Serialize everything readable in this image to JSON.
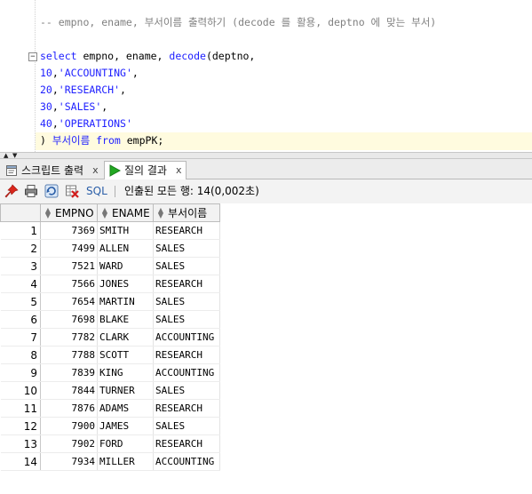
{
  "editor": {
    "comment": "-- empno, ename, 부서이름 출력하기 (decode 를 활용, deptno 에 맞는 부서)",
    "lines": [
      {
        "kw": "select",
        "rest": " empno, ename, ",
        "fn": "decode",
        "tail": "(deptno,"
      },
      {
        "num": "10",
        "str": "'ACCOUNTING'",
        "sep": ","
      },
      {
        "num": "20",
        "str": "'RESEARCH'",
        "sep": ","
      },
      {
        "num": "30",
        "str": "'SALES'",
        "sep": ","
      },
      {
        "num": "40",
        "str": "'OPERATIONS'",
        "sep": ""
      },
      {
        "pre": ") ",
        "alias": "부서이름",
        "mid": " ",
        "kw": "from",
        "tail": " empPK;"
      }
    ]
  },
  "tabs": [
    {
      "label": "스크립트 출력",
      "close": "x",
      "icon": "script-output-icon"
    },
    {
      "label": "질의 결과",
      "close": "x",
      "icon": "run-icon"
    }
  ],
  "toolbar": {
    "sql_label": "SQL",
    "status": "인출된 모든 행: 14(0,002초)"
  },
  "grid": {
    "columns": [
      "EMPNO",
      "ENAME",
      "부서이름"
    ],
    "rows": [
      {
        "n": "1",
        "empno": "7369",
        "ename": "SMITH",
        "dept": "RESEARCH"
      },
      {
        "n": "2",
        "empno": "7499",
        "ename": "ALLEN",
        "dept": "SALES"
      },
      {
        "n": "3",
        "empno": "7521",
        "ename": "WARD",
        "dept": "SALES"
      },
      {
        "n": "4",
        "empno": "7566",
        "ename": "JONES",
        "dept": "RESEARCH"
      },
      {
        "n": "5",
        "empno": "7654",
        "ename": "MARTIN",
        "dept": "SALES"
      },
      {
        "n": "6",
        "empno": "7698",
        "ename": "BLAKE",
        "dept": "SALES"
      },
      {
        "n": "7",
        "empno": "7782",
        "ename": "CLARK",
        "dept": "ACCOUNTING"
      },
      {
        "n": "8",
        "empno": "7788",
        "ename": "SCOTT",
        "dept": "RESEARCH"
      },
      {
        "n": "9",
        "empno": "7839",
        "ename": "KING",
        "dept": "ACCOUNTING"
      },
      {
        "n": "10",
        "empno": "7844",
        "ename": "TURNER",
        "dept": "SALES"
      },
      {
        "n": "11",
        "empno": "7876",
        "ename": "ADAMS",
        "dept": "RESEARCH"
      },
      {
        "n": "12",
        "empno": "7900",
        "ename": "JAMES",
        "dept": "SALES"
      },
      {
        "n": "13",
        "empno": "7902",
        "ename": "FORD",
        "dept": "RESEARCH"
      },
      {
        "n": "14",
        "empno": "7934",
        "ename": "MILLER",
        "dept": "ACCOUNTING"
      }
    ]
  },
  "colors": {
    "keyword": "#1f20ff",
    "comment": "#808080",
    "current_line": "#fffbdf",
    "run_green": "#22a822"
  }
}
